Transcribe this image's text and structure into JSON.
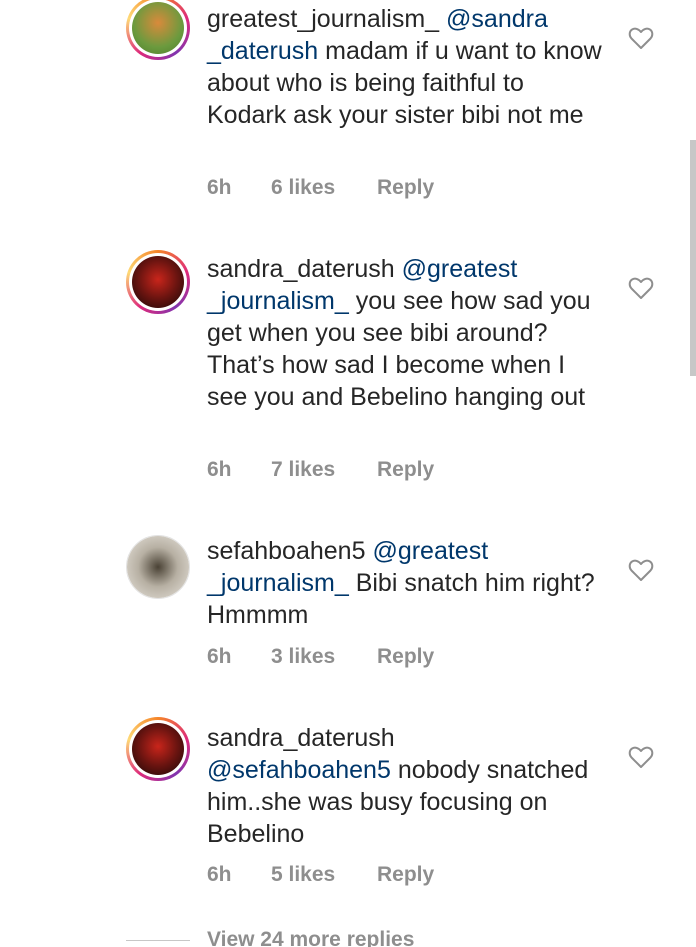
{
  "comments": [
    {
      "username": "greatest_journalism_",
      "mention_pre": "@sandra",
      "mention": "_daterush",
      "text": " madam if u want to know about who is being faithful to Kodark ask your sister bibi not me",
      "time": "6h",
      "likes": "6 likes",
      "reply": "Reply"
    },
    {
      "username": "sandra_daterush",
      "mention": "@greatest _journalism_",
      "text": " you see how sad you get when you see bibi around? That’s how sad I become when I see you and Bebelino hanging out",
      "time": "6h",
      "likes": "7 likes",
      "reply": "Reply"
    },
    {
      "username": "sefahboahen5",
      "mention": "@greatest _journalism_",
      "text": " Bibi snatch him right? Hmmmm",
      "time": "6h",
      "likes": "3 likes",
      "reply": "Reply"
    },
    {
      "username": "sandra_daterush",
      "mention": "@sefahboahen5",
      "text": " nobody snatched him..she was busy focusing on Bebelino",
      "time": "6h",
      "likes": "5 likes",
      "reply": "Reply"
    }
  ],
  "view_more": "View 24 more replies",
  "icons": {
    "like": "heart-outline-icon"
  },
  "colors": {
    "text": "#262626",
    "mention": "#00376b",
    "meta": "#8e8e8e"
  }
}
